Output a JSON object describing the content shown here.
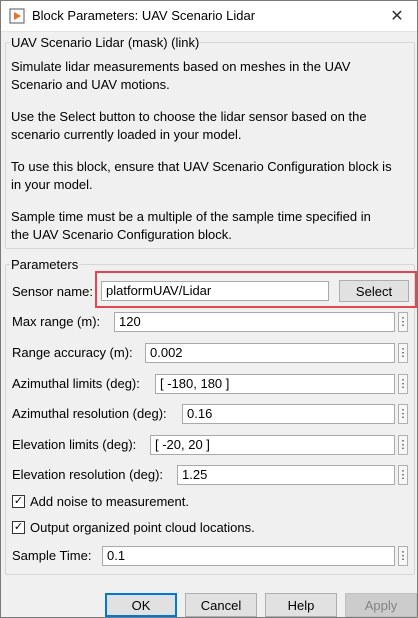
{
  "window": {
    "title": "Block Parameters: UAV Scenario Lidar",
    "close_glyph": "✕"
  },
  "block": {
    "group_title": "UAV Scenario Lidar (mask) (link)",
    "description": [
      "Simulate lidar measurements based on meshes in the UAV",
      "Scenario and UAV motions.",
      "Use the Select button to choose the lidar sensor based on the",
      "scenario currently loaded in your model.",
      "To use this block, ensure that UAV Scenario Configuration block is",
      "in your model.",
      "Sample time must be a multiple of the sample time specified in",
      "the UAV Scenario Configuration block."
    ]
  },
  "parameters": {
    "group_title": "Parameters",
    "sensor_name": {
      "label": "Sensor name:",
      "value": "platformUAV/Lidar",
      "select_label": "Select"
    },
    "max_range": {
      "label": "Max range (m):",
      "value": "120"
    },
    "range_accuracy": {
      "label": "Range accuracy (m):",
      "value": "0.002"
    },
    "azimuthal_limits": {
      "label": "Azimuthal limits (deg):",
      "value": "[ -180, 180 ]"
    },
    "azimuthal_resolution": {
      "label": "Azimuthal resolution (deg):",
      "value": "0.16"
    },
    "elevation_limits": {
      "label": "Elevation limits (deg):",
      "value": "[ -20, 20 ]"
    },
    "elevation_resolution": {
      "label": "Elevation resolution (deg):",
      "value": "1.25"
    },
    "add_noise": {
      "label": "Add noise to measurement.",
      "checked": true,
      "glyph": "✓"
    },
    "organized_cloud": {
      "label": "Output organized point cloud locations.",
      "checked": true,
      "glyph": "✓"
    },
    "sample_time": {
      "label": "Sample Time:",
      "value": "0.1"
    },
    "more_glyph": "⋮"
  },
  "buttons": {
    "ok": "OK",
    "cancel": "Cancel",
    "help": "Help",
    "apply": "Apply"
  },
  "colors": {
    "highlight": "#e4464f",
    "default_button_border": "#0078d7"
  }
}
